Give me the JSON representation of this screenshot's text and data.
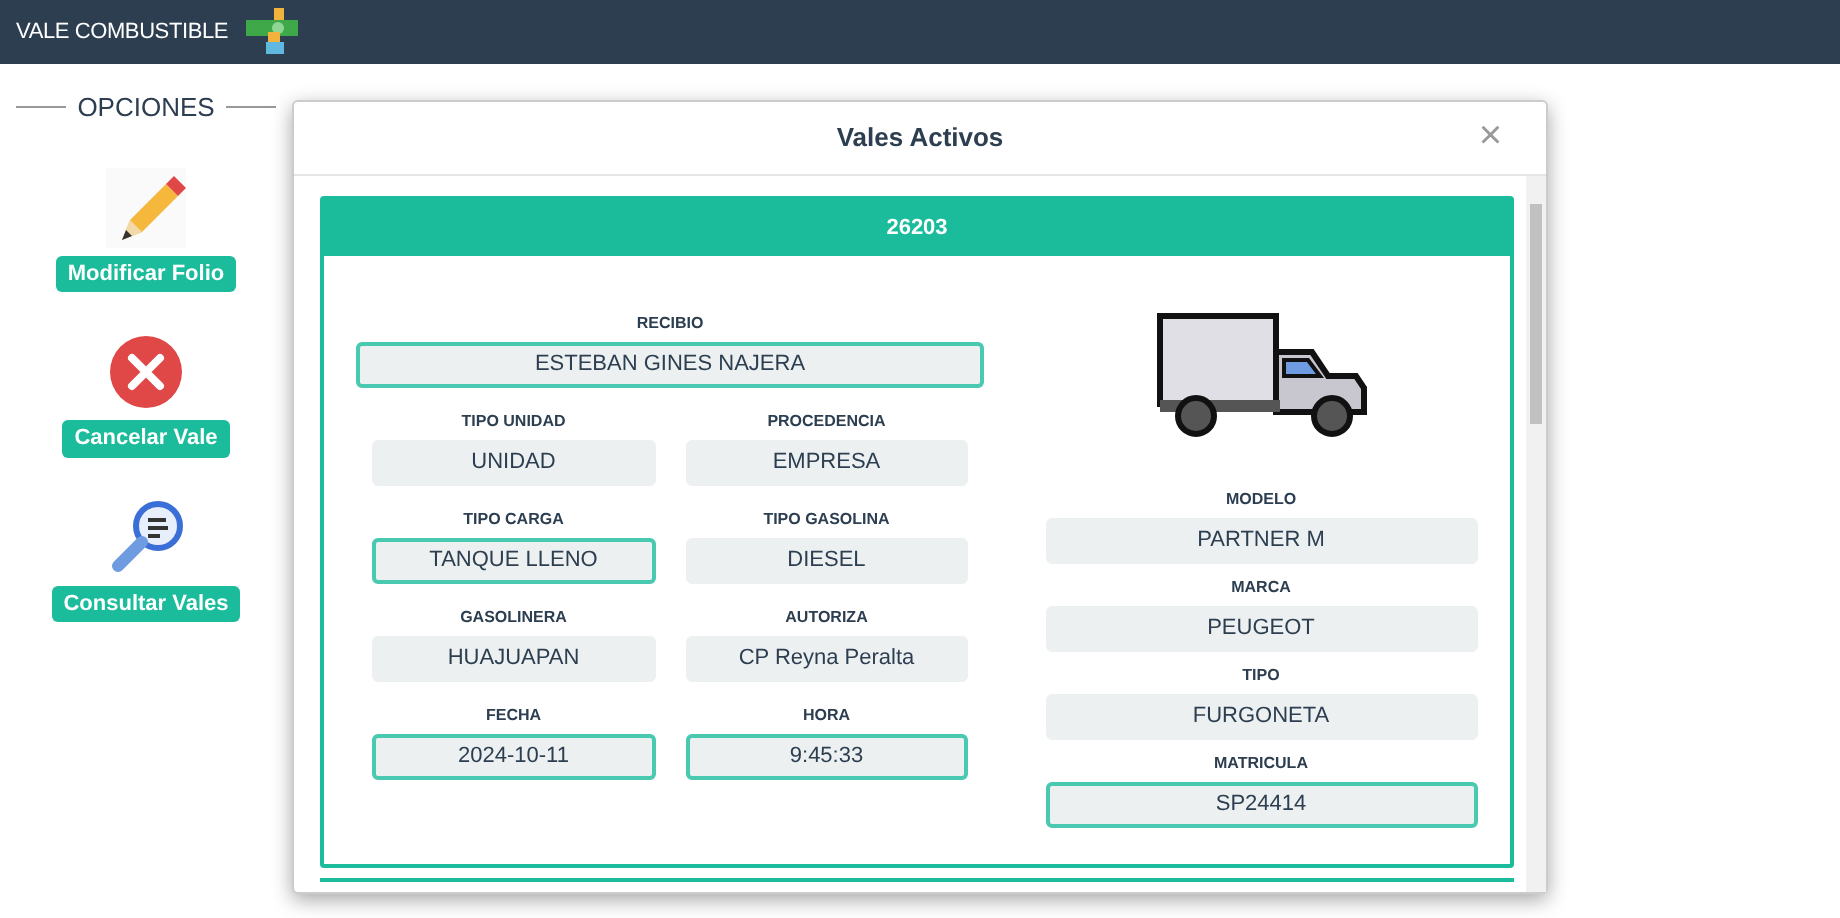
{
  "navbar": {
    "title": "VALE COMBUSTIBLE"
  },
  "sidebar": {
    "legend": "OPCIONES",
    "items": [
      {
        "label": "Modificar Folio",
        "kind": "edit"
      },
      {
        "label": "Cancelar Vale",
        "kind": "cancel"
      },
      {
        "label": "Consultar Vales",
        "kind": "search"
      }
    ]
  },
  "modal": {
    "title": "Vales Activos",
    "close": "×",
    "card": {
      "header": "26203",
      "left_rows": [
        [
          {
            "label": "RECIBIO",
            "value": "ESTEBAN GINES NAJERA",
            "highlighted": true
          }
        ],
        [
          {
            "label": "TIPO UNIDAD",
            "value": "UNIDAD",
            "highlighted": false
          },
          {
            "label": "PROCEDENCIA",
            "value": "EMPRESA",
            "highlighted": false
          }
        ],
        [
          {
            "label": "TIPO CARGA",
            "value": "TANQUE LLENO",
            "highlighted": true
          },
          {
            "label": "TIPO GASOLINA",
            "value": "DIESEL",
            "highlighted": false
          }
        ],
        [
          {
            "label": "GASOLINERA",
            "value": "HUAJUAPAN",
            "highlighted": false
          },
          {
            "label": "AUTORIZA",
            "value": "CP Reyna Peralta",
            "highlighted": false
          }
        ],
        [
          {
            "label": "FECHA",
            "value": "2024-10-11",
            "highlighted": true
          },
          {
            "label": "HORA",
            "value": "9:45:33",
            "highlighted": true
          }
        ]
      ],
      "right_fields": [
        {
          "label": "MODELO",
          "value": "PARTNER M",
          "highlighted": false
        },
        {
          "label": "MARCA",
          "value": "PEUGEOT",
          "highlighted": false
        },
        {
          "label": "TIPO",
          "value": "FURGONETA",
          "highlighted": false
        },
        {
          "label": "MATRICULA",
          "value": "SP24414",
          "highlighted": true
        }
      ]
    }
  }
}
